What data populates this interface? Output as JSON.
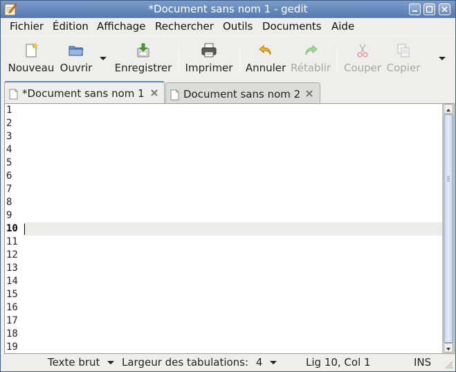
{
  "window": {
    "title": "*Document sans nom 1 - gedit",
    "buttons": {
      "minimize": "minimize-icon",
      "maximize": "maximize-icon",
      "close": "close-icon"
    }
  },
  "menu": {
    "items": [
      {
        "label": "Fichier"
      },
      {
        "label": "Édition"
      },
      {
        "label": "Affichage"
      },
      {
        "label": "Rechercher"
      },
      {
        "label": "Outils"
      },
      {
        "label": "Documents"
      },
      {
        "label": "Aide"
      }
    ]
  },
  "toolbar": {
    "new_label": "Nouveau",
    "open_label": "Ouvrir",
    "save_label": "Enregistrer",
    "print_label": "Imprimer",
    "undo_label": "Annuler",
    "redo_label": "Rétablir",
    "cut_label": "Couper",
    "copy_label": "Copier"
  },
  "tabs": [
    {
      "label": "*Document sans nom 1",
      "active": true
    },
    {
      "label": "Document sans nom 2",
      "active": false
    }
  ],
  "editor": {
    "line_numbers": [
      "1",
      "2",
      "3",
      "4",
      "5",
      "6",
      "7",
      "8",
      "9",
      "10",
      "11",
      "12",
      "13",
      "14",
      "15",
      "16",
      "17",
      "18",
      "19"
    ],
    "current_line": "10",
    "content": ""
  },
  "statusbar": {
    "language": "Texte brut",
    "tab_width_label": "Largeur des tabulations:",
    "tab_width_value": "4",
    "position": "Lig 10, Col 1",
    "mode": "INS"
  },
  "colors": {
    "titlebar": "#5479ad",
    "tab_accent": "#5a84bf",
    "current_line": "#ececea",
    "undo_icon": "#e8a317",
    "save_icon": "#4aa02c"
  }
}
